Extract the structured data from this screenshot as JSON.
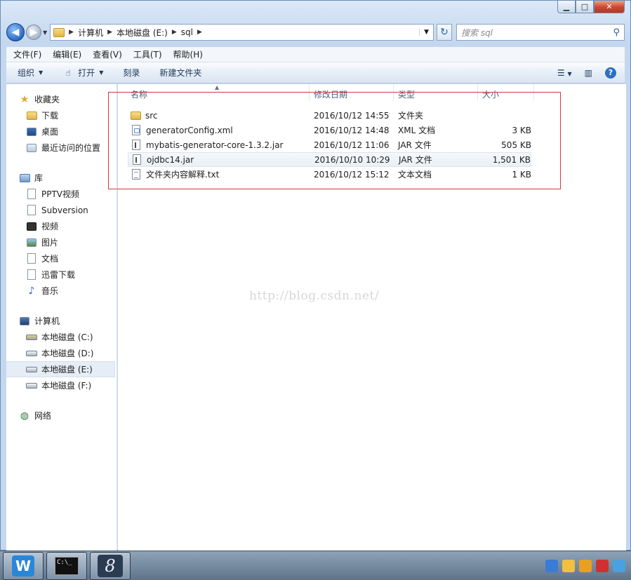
{
  "address": {
    "crumbs": [
      "计算机",
      "本地磁盘 (E:)",
      "sql"
    ],
    "search_placeholder": "搜索 sql"
  },
  "menu": [
    "文件(F)",
    "编辑(E)",
    "查看(V)",
    "工具(T)",
    "帮助(H)"
  ],
  "toolbar": {
    "organize": "组织",
    "open": "打开",
    "burn": "刻录",
    "new_folder": "新建文件夹"
  },
  "nav": {
    "favorites": {
      "label": "收藏夹",
      "items": [
        "下载",
        "桌面",
        "最近访问的位置"
      ]
    },
    "libraries": {
      "label": "库",
      "items": [
        "PPTV视频",
        "Subversion",
        "视频",
        "图片",
        "文档",
        "迅雷下载",
        "音乐"
      ]
    },
    "computer": {
      "label": "计算机",
      "items": [
        "本地磁盘 (C:)",
        "本地磁盘 (D:)",
        "本地磁盘 (E:)",
        "本地磁盘 (F:)"
      ]
    },
    "network": {
      "label": "网络"
    }
  },
  "columns": {
    "name": "名称",
    "date": "修改日期",
    "type": "类型",
    "size": "大小"
  },
  "files": [
    {
      "icon": "folder-icon",
      "name": "src",
      "date": "2016/10/12 14:55",
      "type": "文件夹",
      "size": ""
    },
    {
      "icon": "xml-file-icon",
      "name": "generatorConfig.xml",
      "date": "2016/10/12 14:48",
      "type": "XML 文档",
      "size": "3 KB"
    },
    {
      "icon": "jar-file-icon",
      "name": "mybatis-generator-core-1.3.2.jar",
      "date": "2016/10/12 11:06",
      "type": "JAR 文件",
      "size": "505 KB"
    },
    {
      "icon": "jar-file-icon",
      "name": "ojdbc14.jar",
      "date": "2016/10/10 10:29",
      "type": "JAR 文件",
      "size": "1,501 KB"
    },
    {
      "icon": "text-file-icon",
      "name": "文件夹内容解释.txt",
      "date": "2016/10/12 15:12",
      "type": "文本文档",
      "size": "1 KB"
    }
  ],
  "watermark": "http://blog.csdn.net/",
  "colors": {
    "highlight_box": "#d9363e",
    "selected_row": "#e5edf6"
  }
}
